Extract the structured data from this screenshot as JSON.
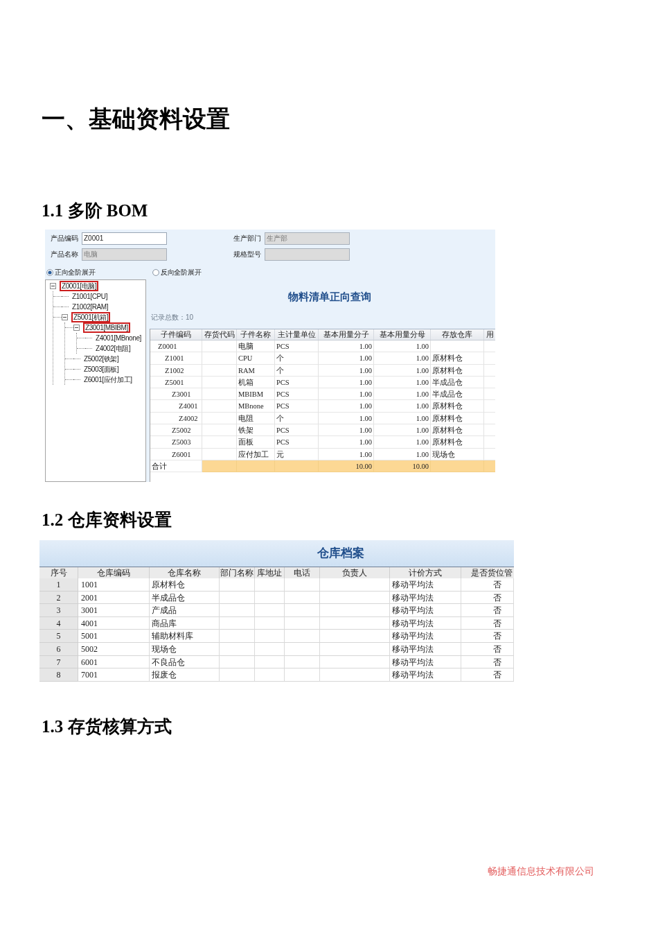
{
  "page_title": "一、基础资料设置",
  "section_1": {
    "title": "1.1 多阶 BOM",
    "bom_query": {
      "fields": [
        {
          "label": "产品编码",
          "value": "Z0001",
          "disabled": false
        },
        {
          "label": "生产部门",
          "value": "生产部",
          "disabled": true
        },
        {
          "label": "产品名称",
          "value": "电脑",
          "disabled": true
        },
        {
          "label": "规格型号",
          "disabled": true
        }
      ],
      "expand_options": [
        {
          "label": "正向全阶展开",
          "selected": true
        },
        {
          "label": "反向全阶展开",
          "selected": false
        }
      ],
      "tree": [
        {
          "label": "Z0001[电脑]",
          "highlighted": true,
          "expanded": true,
          "children": [
            {
              "label": "Z1001[CPU]",
              "highlighted": false
            },
            {
              "label": "Z1002[RAM]",
              "highlighted": false
            },
            {
              "label": "Z5001[机箱]",
              "highlighted": true,
              "expanded": true,
              "children": [
                {
                  "label": "Z3001[MBIBM]",
                  "highlighted": true,
                  "expanded": true,
                  "children": [
                    {
                      "label": "Z4001[MBnone]",
                      "highlighted": false
                    },
                    {
                      "label": "Z4002[电阻]",
                      "highlighted": false
                    }
                  ]
                },
                {
                  "label": "Z5002[铁架]",
                  "highlighted": false
                },
                {
                  "label": "Z5003[面板]",
                  "highlighted": false
                },
                {
                  "label": "Z6001[应付加工]",
                  "highlighted": false
                }
              ]
            }
          ]
        }
      ],
      "title": "物料清单正向查询",
      "record_count": "记录总数：10",
      "columns": [
        "子件编码",
        "存货代码",
        "子件名称",
        "主计量单位",
        "基本用量分子",
        "基本用量分母",
        "存放仓库",
        "用"
      ],
      "rows": [
        {
          "code": "Z0001",
          "name": "电脑",
          "unit": "PCS",
          "numerator": "1.00",
          "denominator": "1.00",
          "children": [
            {
              "code": "Z1001",
              "name": "CPU",
              "unit": "个",
              "numerator": "1.00",
              "denominator": "1.00",
              "warehouse": "原材料仓"
            },
            {
              "code": "Z1002",
              "name": "RAM",
              "unit": "个",
              "numerator": "1.00",
              "denominator": "1.00",
              "warehouse": "原材料仓"
            },
            {
              "code": "Z5001",
              "name": "机箱",
              "unit": "PCS",
              "numerator": "1.00",
              "denominator": "1.00",
              "warehouse": "半成品仓",
              "children": [
                {
                  "code": "Z3001",
                  "name": "MBIBM",
                  "unit": "PCS",
                  "numerator": "1.00",
                  "denominator": "1.00",
                  "warehouse": "半成品仓",
                  "children": [
                    {
                      "code": "Z4001",
                      "name": "MBnone",
                      "unit": "PCS",
                      "numerator": "1.00",
                      "denominator": "1.00",
                      "warehouse": "原材料仓"
                    },
                    {
                      "code": "Z4002",
                      "name": "电阻",
                      "unit": "个",
                      "numerator": "1.00",
                      "denominator": "1.00",
                      "warehouse": "原材料仓"
                    }
                  ]
                },
                {
                  "code": "Z5002",
                  "name": "铁架",
                  "unit": "PCS",
                  "numerator": "1.00",
                  "denominator": "1.00",
                  "warehouse": "原材料仓"
                },
                {
                  "code": "Z5003",
                  "name": "面板",
                  "unit": "PCS",
                  "numerator": "1.00",
                  "denominator": "1.00",
                  "warehouse": "原材料仓"
                },
                {
                  "code": "Z6001",
                  "name": "应付加工",
                  "unit": "元",
                  "numerator": "1.00",
                  "denominator": "1.00",
                  "warehouse": "现场仓"
                }
              ]
            }
          ]
        }
      ],
      "total": {
        "label": "合计",
        "numerator": "10.00",
        "denominator": "10.00"
      }
    }
  },
  "section_2": {
    "title": "1.2 仓库资料设置",
    "warehouse_list": {
      "title": "仓库档案",
      "columns": [
        "序号",
        "仓库编码",
        "仓库名称",
        "部门名称",
        "库地址",
        "电话",
        "负责人",
        "计价方式",
        "是否货位管"
      ],
      "rows": [
        {
          "no": "1",
          "code": "1001",
          "name": "原材料仓",
          "costing_method": "移动平均法",
          "location_managed": "否"
        },
        {
          "no": "2",
          "code": "2001",
          "name": "半成品仓",
          "costing_method": "移动平均法",
          "location_managed": "否"
        },
        {
          "no": "3",
          "code": "3001",
          "name": "产成品",
          "costing_method": "移动平均法",
          "location_managed": "否"
        },
        {
          "no": "4",
          "code": "4001",
          "name": "商品库",
          "costing_method": "移动平均法",
          "location_managed": "否"
        },
        {
          "no": "5",
          "code": "5001",
          "name": "辅助材料库",
          "costing_method": "移动平均法",
          "location_managed": "否"
        },
        {
          "no": "6",
          "code": "5002",
          "name": "现场仓",
          "costing_method": "移动平均法",
          "location_managed": "否"
        },
        {
          "no": "7",
          "code": "6001",
          "name": "不良品仓",
          "costing_method": "移动平均法",
          "location_managed": "否"
        },
        {
          "no": "8",
          "code": "7001",
          "name": "报废仓",
          "costing_method": "移动平均法",
          "location_managed": "否"
        }
      ]
    }
  },
  "section_3": {
    "title": "1.3 存货核算方式"
  },
  "footer": "畅捷通信息技术有限公司"
}
